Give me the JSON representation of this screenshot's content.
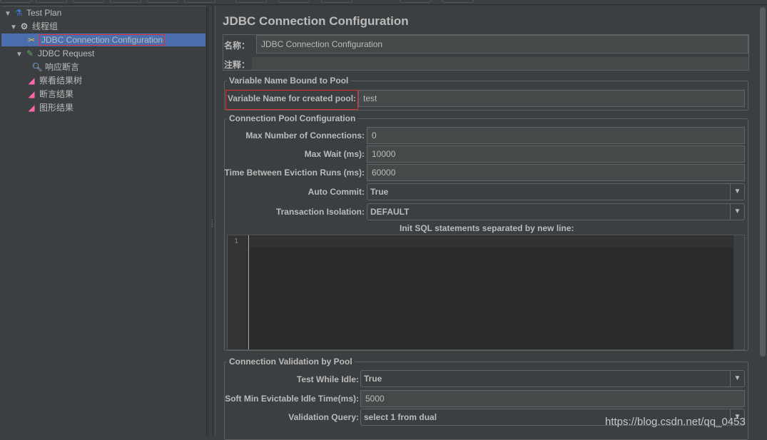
{
  "tree": [
    {
      "label": "Test Plan",
      "icon": "flask-icon"
    },
    {
      "label": "线程组",
      "icon": "gear-icon"
    },
    {
      "label": "JDBC Connection Configuration",
      "icon": "tools-icon",
      "selected": true
    },
    {
      "label": "JDBC Request",
      "icon": "pipette-icon"
    },
    {
      "label": "响应断言",
      "icon": "magnifier-icon"
    },
    {
      "label": "察看结果树",
      "icon": "chart-icon"
    },
    {
      "label": "断言结果",
      "icon": "chart-icon"
    },
    {
      "label": "图形结果",
      "icon": "chart-icon"
    }
  ],
  "main": {
    "title": "JDBC Connection Configuration",
    "name_label": "名称：",
    "name_value": "JDBC Connection Configuration",
    "comment_label": "注释：",
    "comment_value": "",
    "var_section": "Variable Name Bound to Pool",
    "var_label": "Variable Name for created pool:",
    "var_value": "test",
    "pool_section": "Connection Pool Configuration",
    "max_conn_label": "Max Number of Connections:",
    "max_conn_value": "0",
    "max_wait_label": "Max Wait (ms):",
    "max_wait_value": "10000",
    "eviction_label": "Time Between Eviction Runs (ms):",
    "eviction_value": "60000",
    "auto_commit_label": "Auto Commit:",
    "auto_commit_value": "True",
    "isolation_label": "Transaction Isolation:",
    "isolation_value": "DEFAULT",
    "init_sql_label": "Init SQL statements separated by new line:",
    "line_number": "1",
    "validation_section": "Connection Validation by Pool",
    "test_idle_label": "Test While Idle:",
    "test_idle_value": "True",
    "soft_min_label": "Soft Min Evictable Idle Time(ms):",
    "soft_min_value": "5000",
    "validation_query_label": "Validation Query:",
    "validation_query_value": "select 1 from dual"
  },
  "watermark": "https://blog.csdn.net/qq_0453",
  "colors": {
    "background": "#3c3f41",
    "selection": "#4b6eaf",
    "highlight_box": "#e03030"
  }
}
